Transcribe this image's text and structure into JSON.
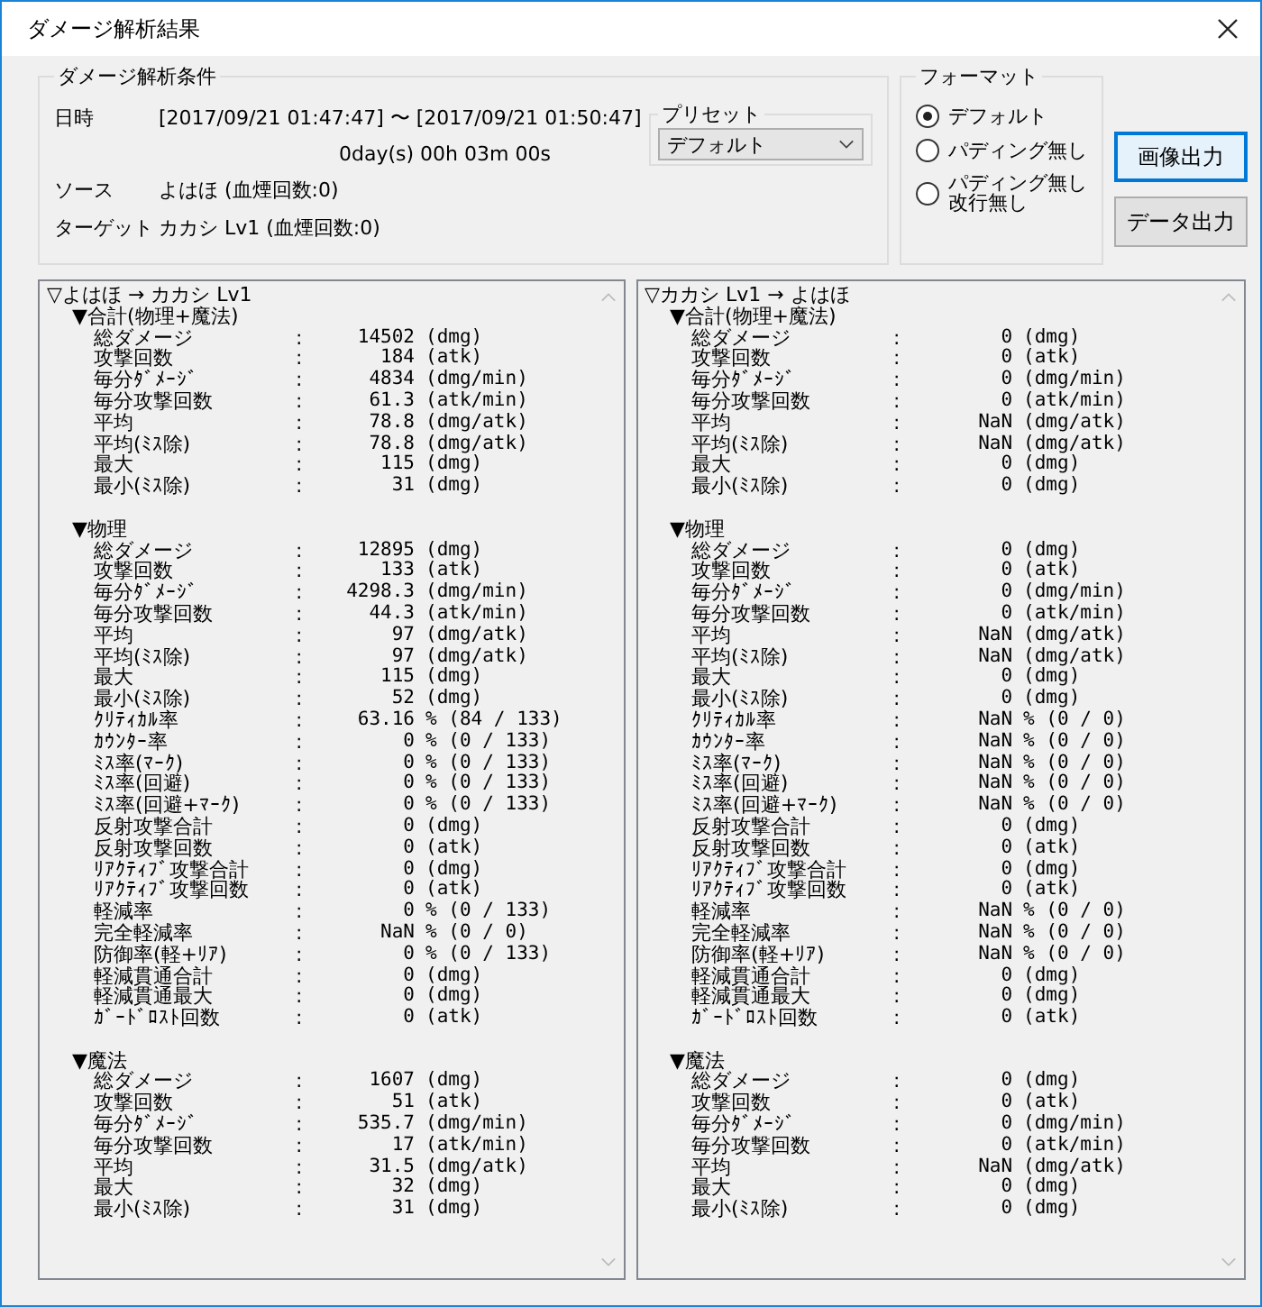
{
  "window": {
    "title": "ダメージ解析結果"
  },
  "conditions": {
    "title": "ダメージ解析条件",
    "date_label": "日時",
    "date_range": "[2017/09/21 01:47:47] 〜 [2017/09/21 01:50:47]",
    "duration": "0day(s) 00h 03m 00s",
    "source_label": "ソース",
    "source": "よはほ (血煙回数:0)",
    "target_label": "ターゲット",
    "target": "カカシ Lv1 (血煙回数:0)"
  },
  "preset": {
    "title": "プリセット",
    "value": "デフォルト"
  },
  "format": {
    "title": "フォーマット",
    "options": [
      {
        "lines": [
          "デフォルト"
        ],
        "selected": true
      },
      {
        "lines": [
          "パディング無し"
        ],
        "selected": false
      },
      {
        "lines": [
          "パディング無し",
          "改行無し"
        ],
        "selected": false
      }
    ]
  },
  "buttons": [
    {
      "label": "画像出力",
      "focused": true
    },
    {
      "label": "データ出力",
      "focused": false
    }
  ],
  "panels": [
    {
      "title": "▽よはほ → カカシ Lv1",
      "sections": [
        {
          "title": "▼合計(物理+魔法)",
          "rows": [
            {
              "label": "総ダメージ",
              "sep": ":",
              "value": "14502",
              "unit": "(dmg)"
            },
            {
              "label": "攻撃回数",
              "sep": ":",
              "value": "184",
              "unit": "(atk)"
            },
            {
              "label": "毎分ﾀﾞﾒｰｼﾞ",
              "sep": ":",
              "value": "4834",
              "unit": "(dmg/min)"
            },
            {
              "label": "毎分攻撃回数",
              "sep": ":",
              "value": "61.3",
              "unit": "(atk/min)"
            },
            {
              "label": "平均",
              "sep": ":",
              "value": "78.8",
              "unit": "(dmg/atk)"
            },
            {
              "label": "平均(ﾐｽ除)",
              "sep": ":",
              "value": "78.8",
              "unit": "(dmg/atk)"
            },
            {
              "label": "最大",
              "sep": ":",
              "value": "115",
              "unit": "(dmg)"
            },
            {
              "label": "最小(ﾐｽ除)",
              "sep": ":",
              "value": "31",
              "unit": "(dmg)"
            }
          ]
        },
        {
          "title": "▼物理",
          "rows": [
            {
              "label": "総ダメージ",
              "sep": ":",
              "value": "12895",
              "unit": "(dmg)"
            },
            {
              "label": "攻撃回数",
              "sep": ":",
              "value": "133",
              "unit": "(atk)"
            },
            {
              "label": "毎分ﾀﾞﾒｰｼﾞ",
              "sep": ":",
              "value": "4298.3",
              "unit": "(dmg/min)"
            },
            {
              "label": "毎分攻撃回数",
              "sep": ":",
              "value": "44.3",
              "unit": "(atk/min)"
            },
            {
              "label": "平均",
              "sep": ":",
              "value": "97",
              "unit": "(dmg/atk)"
            },
            {
              "label": "平均(ﾐｽ除)",
              "sep": ":",
              "value": "97",
              "unit": "(dmg/atk)"
            },
            {
              "label": "最大",
              "sep": ":",
              "value": "115",
              "unit": "(dmg)"
            },
            {
              "label": "最小(ﾐｽ除)",
              "sep": ":",
              "value": "52",
              "unit": "(dmg)"
            },
            {
              "label": "ｸﾘﾃｨｶﾙ率",
              "sep": ":",
              "value": "63.16",
              "unit": "% (84 / 133)"
            },
            {
              "label": "ｶｳﾝﾀｰ率",
              "sep": ":",
              "value": "0",
              "unit": "% (0 / 133)"
            },
            {
              "label": "ﾐｽ率(ﾏｰｸ)",
              "sep": ":",
              "value": "0",
              "unit": "% (0 / 133)"
            },
            {
              "label": "ﾐｽ率(回避)",
              "sep": ":",
              "value": "0",
              "unit": "% (0 / 133)"
            },
            {
              "label": "ﾐｽ率(回避+ﾏｰｸ)",
              "sep": ":",
              "value": "0",
              "unit": "% (0 / 133)"
            },
            {
              "label": "反射攻撃合計",
              "sep": ":",
              "value": "0",
              "unit": "(dmg)"
            },
            {
              "label": "反射攻撃回数",
              "sep": ":",
              "value": "0",
              "unit": "(atk)"
            },
            {
              "label": "ﾘｱｸﾃｨﾌﾞ攻撃合計",
              "sep": ":",
              "value": "0",
              "unit": "(dmg)"
            },
            {
              "label": "ﾘｱｸﾃｨﾌﾞ攻撃回数",
              "sep": ":",
              "value": "0",
              "unit": "(atk)"
            },
            {
              "label": "軽減率",
              "sep": ":",
              "value": "0",
              "unit": "% (0 / 133)"
            },
            {
              "label": "完全軽減率",
              "sep": ":",
              "value": "NaN",
              "unit": "% (0 / 0)"
            },
            {
              "label": "防御率(軽+ﾘｱ)",
              "sep": ":",
              "value": "0",
              "unit": "% (0 / 133)"
            },
            {
              "label": "軽減貫通合計",
              "sep": ":",
              "value": "0",
              "unit": "(dmg)"
            },
            {
              "label": "軽減貫通最大",
              "sep": ":",
              "value": "0",
              "unit": "(dmg)"
            },
            {
              "label": "ｶﾞｰﾄﾞﾛｽﾄ回数",
              "sep": ":",
              "value": "0",
              "unit": "(atk)"
            }
          ]
        },
        {
          "title": "▼魔法",
          "rows": [
            {
              "label": "総ダメージ",
              "sep": ":",
              "value": "1607",
              "unit": "(dmg)"
            },
            {
              "label": "攻撃回数",
              "sep": ":",
              "value": "51",
              "unit": "(atk)"
            },
            {
              "label": "毎分ﾀﾞﾒｰｼﾞ",
              "sep": ":",
              "value": "535.7",
              "unit": "(dmg/min)"
            },
            {
              "label": "毎分攻撃回数",
              "sep": ":",
              "value": "17",
              "unit": "(atk/min)"
            },
            {
              "label": "平均",
              "sep": ":",
              "value": "31.5",
              "unit": "(dmg/atk)"
            },
            {
              "label": "最大",
              "sep": ":",
              "value": "32",
              "unit": "(dmg)"
            },
            {
              "label": "最小(ﾐｽ除)",
              "sep": ":",
              "value": "31",
              "unit": "(dmg)"
            }
          ]
        }
      ]
    },
    {
      "title": "▽カカシ Lv1 → よはほ",
      "sections": [
        {
          "title": "▼合計(物理+魔法)",
          "rows": [
            {
              "label": "総ダメージ",
              "sep": ":",
              "value": "0",
              "unit": "(dmg)"
            },
            {
              "label": "攻撃回数",
              "sep": ":",
              "value": "0",
              "unit": "(atk)"
            },
            {
              "label": "毎分ﾀﾞﾒｰｼﾞ",
              "sep": ":",
              "value": "0",
              "unit": "(dmg/min)"
            },
            {
              "label": "毎分攻撃回数",
              "sep": ":",
              "value": "0",
              "unit": "(atk/min)"
            },
            {
              "label": "平均",
              "sep": ":",
              "value": "NaN",
              "unit": "(dmg/atk)"
            },
            {
              "label": "平均(ﾐｽ除)",
              "sep": ":",
              "value": "NaN",
              "unit": "(dmg/atk)"
            },
            {
              "label": "最大",
              "sep": ":",
              "value": "0",
              "unit": "(dmg)"
            },
            {
              "label": "最小(ﾐｽ除)",
              "sep": ":",
              "value": "0",
              "unit": "(dmg)"
            }
          ]
        },
        {
          "title": "▼物理",
          "rows": [
            {
              "label": "総ダメージ",
              "sep": ":",
              "value": "0",
              "unit": "(dmg)"
            },
            {
              "label": "攻撃回数",
              "sep": ":",
              "value": "0",
              "unit": "(atk)"
            },
            {
              "label": "毎分ﾀﾞﾒｰｼﾞ",
              "sep": ":",
              "value": "0",
              "unit": "(dmg/min)"
            },
            {
              "label": "毎分攻撃回数",
              "sep": ":",
              "value": "0",
              "unit": "(atk/min)"
            },
            {
              "label": "平均",
              "sep": ":",
              "value": "NaN",
              "unit": "(dmg/atk)"
            },
            {
              "label": "平均(ﾐｽ除)",
              "sep": ":",
              "value": "NaN",
              "unit": "(dmg/atk)"
            },
            {
              "label": "最大",
              "sep": ":",
              "value": "0",
              "unit": "(dmg)"
            },
            {
              "label": "最小(ﾐｽ除)",
              "sep": ":",
              "value": "0",
              "unit": "(dmg)"
            },
            {
              "label": "ｸﾘﾃｨｶﾙ率",
              "sep": ":",
              "value": "NaN",
              "unit": "% (0 / 0)"
            },
            {
              "label": "ｶｳﾝﾀｰ率",
              "sep": ":",
              "value": "NaN",
              "unit": "% (0 / 0)"
            },
            {
              "label": "ﾐｽ率(ﾏｰｸ)",
              "sep": ":",
              "value": "NaN",
              "unit": "% (0 / 0)"
            },
            {
              "label": "ﾐｽ率(回避)",
              "sep": ":",
              "value": "NaN",
              "unit": "% (0 / 0)"
            },
            {
              "label": "ﾐｽ率(回避+ﾏｰｸ)",
              "sep": ":",
              "value": "NaN",
              "unit": "% (0 / 0)"
            },
            {
              "label": "反射攻撃合計",
              "sep": ":",
              "value": "0",
              "unit": "(dmg)"
            },
            {
              "label": "反射攻撃回数",
              "sep": ":",
              "value": "0",
              "unit": "(atk)"
            },
            {
              "label": "ﾘｱｸﾃｨﾌﾞ攻撃合計",
              "sep": ":",
              "value": "0",
              "unit": "(dmg)"
            },
            {
              "label": "ﾘｱｸﾃｨﾌﾞ攻撃回数",
              "sep": ":",
              "value": "0",
              "unit": "(atk)"
            },
            {
              "label": "軽減率",
              "sep": ":",
              "value": "NaN",
              "unit": "% (0 / 0)"
            },
            {
              "label": "完全軽減率",
              "sep": ":",
              "value": "NaN",
              "unit": "% (0 / 0)"
            },
            {
              "label": "防御率(軽+ﾘｱ)",
              "sep": ":",
              "value": "NaN",
              "unit": "% (0 / 0)"
            },
            {
              "label": "軽減貫通合計",
              "sep": ":",
              "value": "0",
              "unit": "(dmg)"
            },
            {
              "label": "軽減貫通最大",
              "sep": ":",
              "value": "0",
              "unit": "(dmg)"
            },
            {
              "label": "ｶﾞｰﾄﾞﾛｽﾄ回数",
              "sep": ":",
              "value": "0",
              "unit": "(atk)"
            }
          ]
        },
        {
          "title": "▼魔法",
          "rows": [
            {
              "label": "総ダメージ",
              "sep": ":",
              "value": "0",
              "unit": "(dmg)"
            },
            {
              "label": "攻撃回数",
              "sep": ":",
              "value": "0",
              "unit": "(atk)"
            },
            {
              "label": "毎分ﾀﾞﾒｰｼﾞ",
              "sep": ":",
              "value": "0",
              "unit": "(dmg/min)"
            },
            {
              "label": "毎分攻撃回数",
              "sep": ":",
              "value": "0",
              "unit": "(atk/min)"
            },
            {
              "label": "平均",
              "sep": ":",
              "value": "NaN",
              "unit": "(dmg/atk)"
            },
            {
              "label": "最大",
              "sep": ":",
              "value": "0",
              "unit": "(dmg)"
            },
            {
              "label": "最小(ﾐｽ除)",
              "sep": ":",
              "value": "0",
              "unit": "(dmg)"
            }
          ]
        }
      ]
    }
  ]
}
